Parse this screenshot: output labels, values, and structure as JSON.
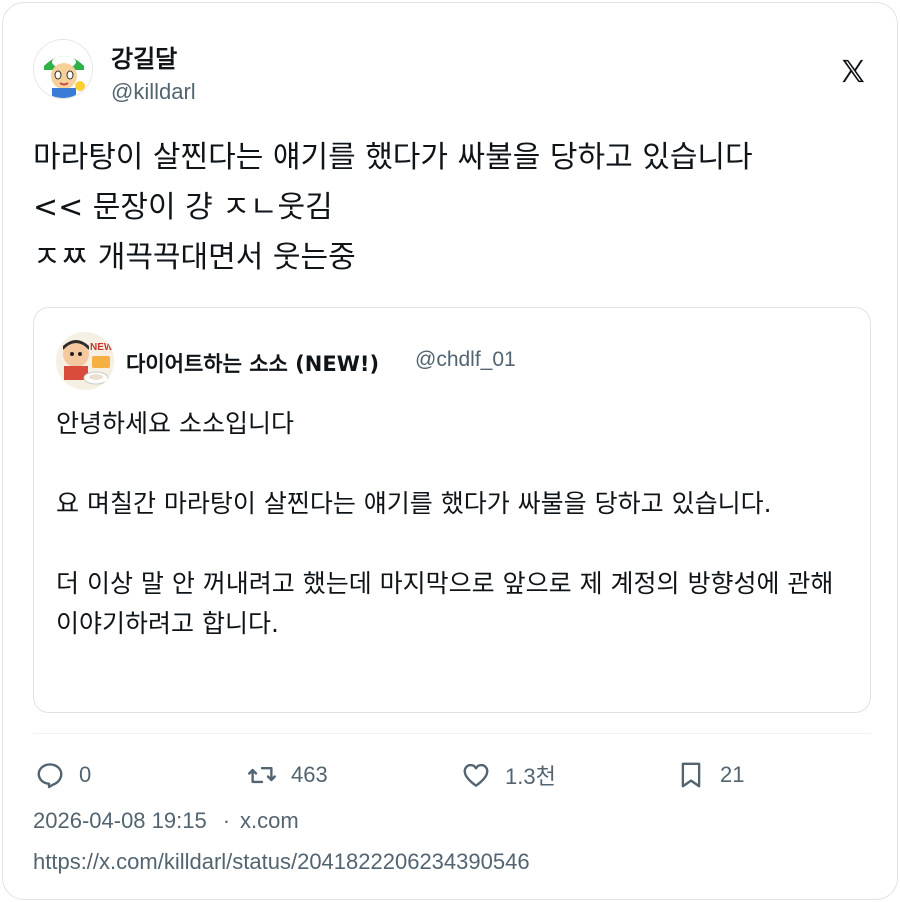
{
  "author": {
    "name": "강길달",
    "handle": "@killdarl",
    "avatar_icon": "cartoon-avatar-icon"
  },
  "platform_icon": "x-logo-icon",
  "tweet": {
    "lines": [
      "마라탕이 살찐다는 얘기를 했다가 싸불을 당하고 있습니다",
      "<< 문장이 걍 ㅈㄴ웃김",
      "ㅈㅉ 개끅끅대면서 웃는중"
    ]
  },
  "quote": {
    "name": "다이어트하는 소소 (NEW!)",
    "handle": "@chdlf_01",
    "paragraphs": [
      "안녕하세요 소소입니다",
      "요 며칠간 마라탕이 살찐다는 얘기를 했다가 싸불을 당하고 있습니다.",
      "더 이상 말 안 꺼내려고 했는데 마지막으로 앞으로 제 계정의 방향성에 관해 이야기하려고 합니다."
    ]
  },
  "actions": {
    "reply": {
      "icon": "reply-icon",
      "count": "0"
    },
    "retweet": {
      "icon": "retweet-icon",
      "count": "463"
    },
    "like": {
      "icon": "heart-icon",
      "count": "1.3천"
    },
    "bookmark": {
      "icon": "bookmark-icon",
      "count": "21"
    }
  },
  "meta": {
    "timestamp": "2026-04-08 19:15",
    "separator": "·",
    "source": "x.com"
  },
  "url": "https://x.com/killdarl/status/2041822206234390546",
  "colors": {
    "text": "#0f1419",
    "secondary": "#536471",
    "border": "#dfe3e6"
  }
}
